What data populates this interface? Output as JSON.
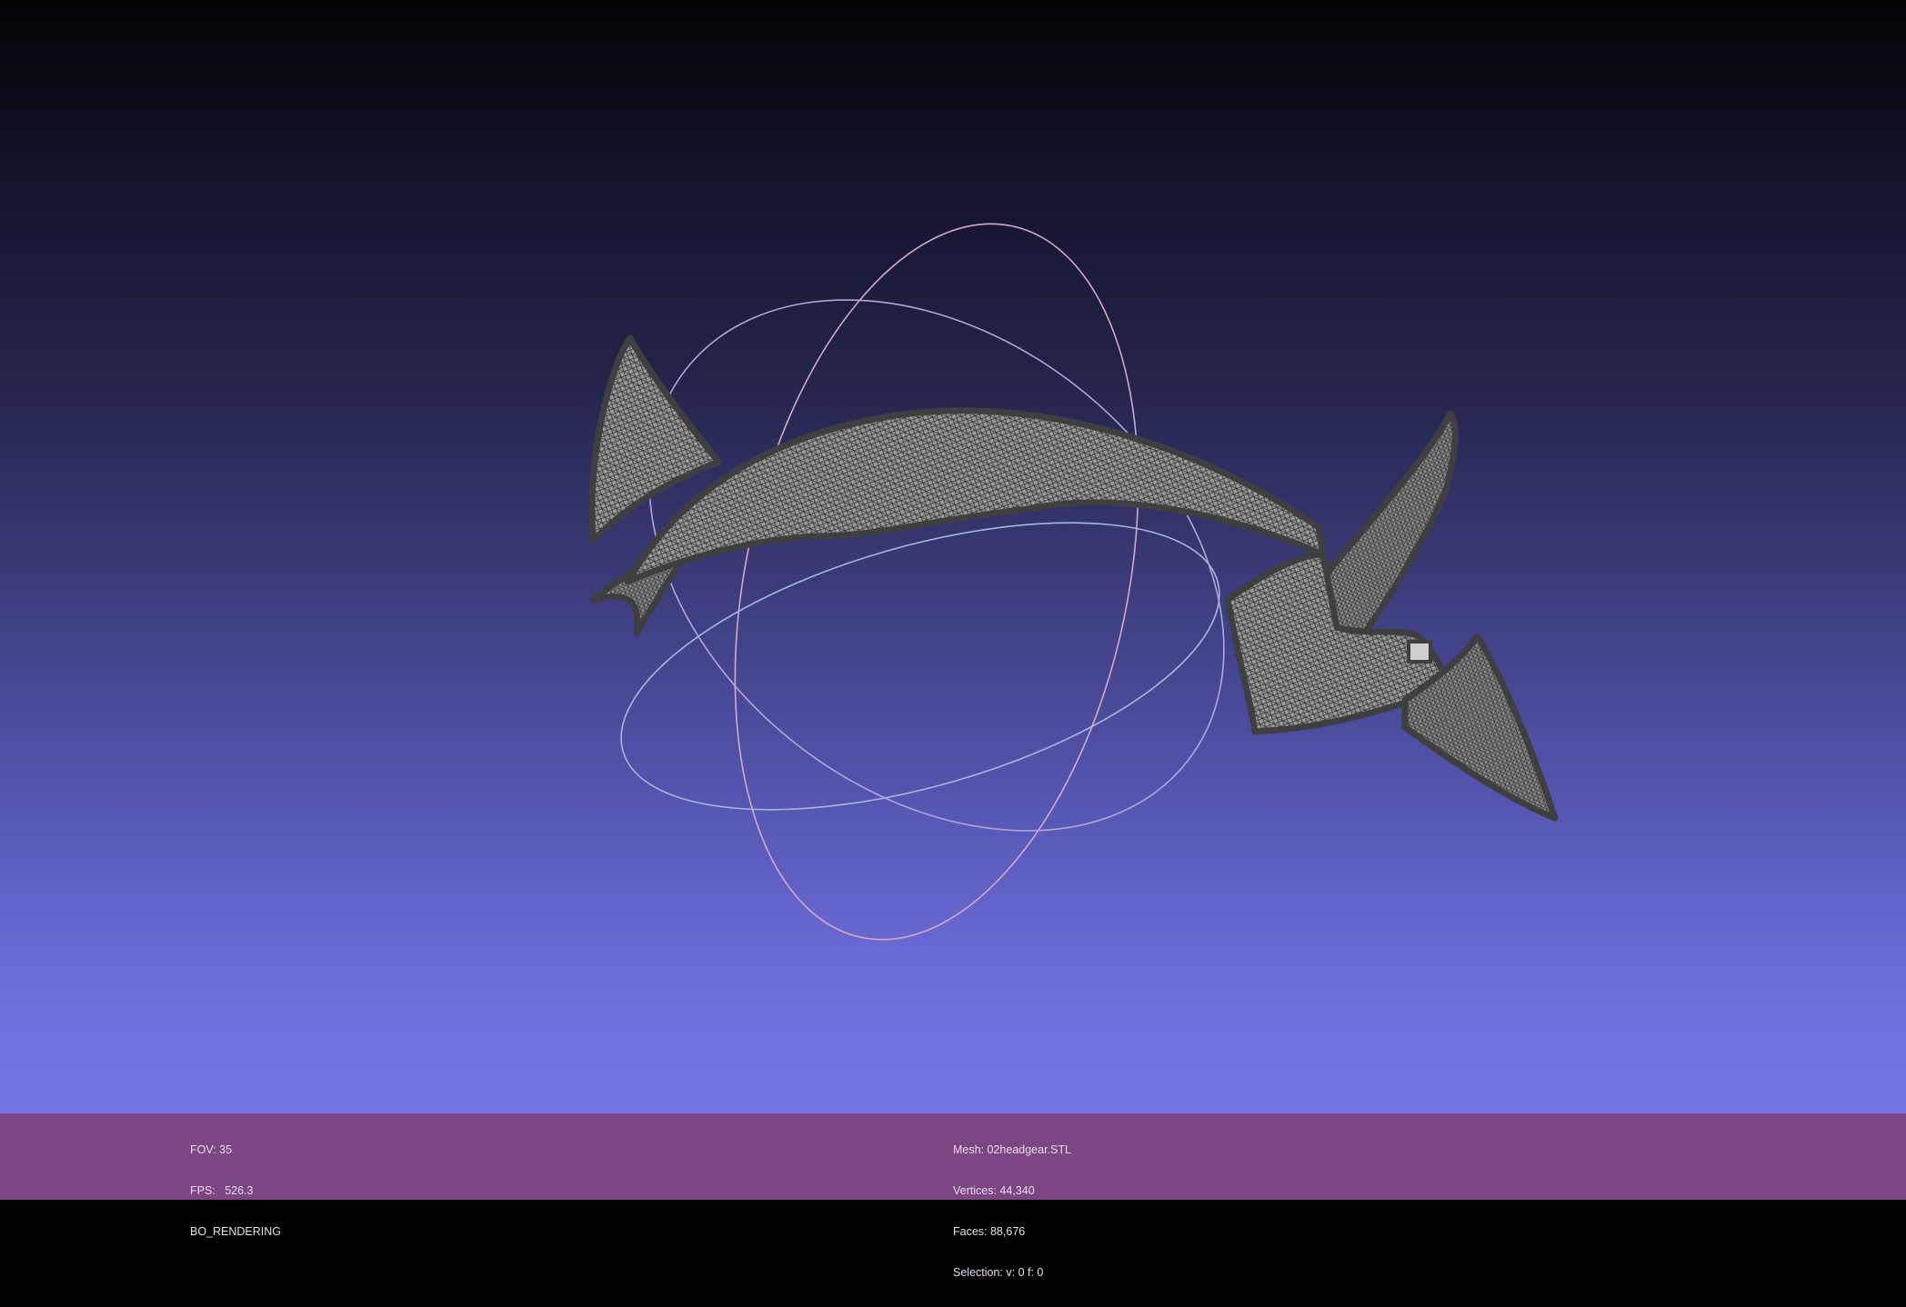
{
  "viewport": {
    "mesh_fill": "#9a9a9a",
    "mesh_edge": "#3f3f42",
    "trackball_colors": [
      "#d6a8c8",
      "#a9b7dc",
      "#b3a6d8"
    ]
  },
  "info_left": {
    "fov": "FOV: 35",
    "fps": "FPS:   526.3",
    "rendering": "BO_RENDERING"
  },
  "info_center": {
    "mesh": "Mesh: 02headgear.STL",
    "vertices": "Vertices: 44,340",
    "faces": "Faces: 88,676",
    "selection": "Selection: v: 0 f: 0"
  },
  "colors": {
    "info_bar": "#7e4585",
    "info_text": "#e9dcef"
  }
}
